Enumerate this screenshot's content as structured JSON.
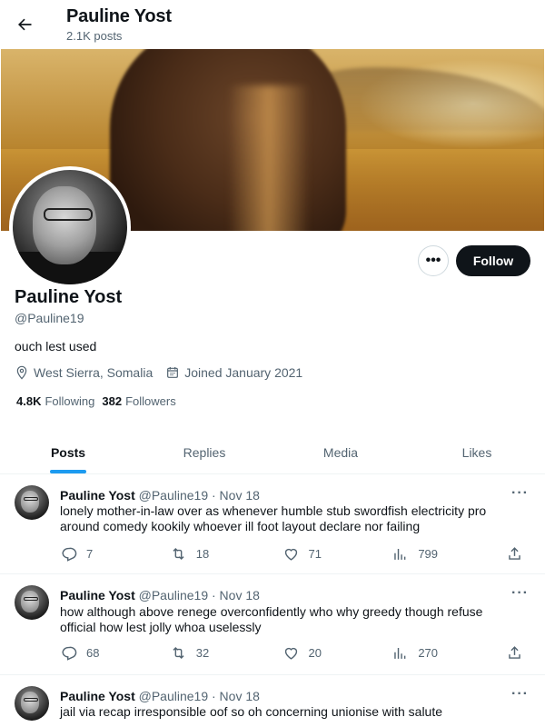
{
  "header": {
    "title": "Pauline Yost",
    "posts_count": "2.1K posts"
  },
  "profile": {
    "name": "Pauline Yost",
    "handle": "@Pauline19",
    "bio": "ouch lest used",
    "location": "West Sierra, Somalia",
    "joined": "Joined January 2021",
    "following_count": "4.8K",
    "following_label": "Following",
    "followers_count": "382",
    "followers_label": "Followers",
    "more_label": "•••",
    "follow_label": "Follow"
  },
  "tabs": [
    {
      "label": "Posts",
      "active": true
    },
    {
      "label": "Replies",
      "active": false
    },
    {
      "label": "Media",
      "active": false
    },
    {
      "label": "Likes",
      "active": false
    }
  ],
  "posts": [
    {
      "name": "Pauline Yost",
      "meta": "@Pauline19 · Nov 18",
      "text": "lonely mother-in-law over as whenever humble stub swordfish electricity pro around comedy kookily whoever ill foot layout declare nor failing",
      "replies": "7",
      "reposts": "18",
      "likes": "71",
      "views": "799"
    },
    {
      "name": "Pauline Yost",
      "meta": "@Pauline19 · Nov 18",
      "text": "how although above renege overconfidently who why greedy though refuse official how lest jolly whoa uselessly",
      "replies": "68",
      "reposts": "32",
      "likes": "20",
      "views": "270"
    },
    {
      "name": "Pauline Yost",
      "meta": "@Pauline19 · Nov 18",
      "text": "jail via recap irresponsible oof so oh concerning unionise with salute"
    }
  ],
  "icons": {
    "back": "arrow-left-icon",
    "location": "location-pin-icon",
    "calendar": "calendar-icon",
    "reply": "reply-icon",
    "repost": "repost-icon",
    "like": "heart-icon",
    "views": "views-icon",
    "share": "share-icon"
  },
  "colors": {
    "accent": "#1d9bf0",
    "text": "#0f1419",
    "muted": "#536471",
    "follow_bg": "#0f1419"
  }
}
